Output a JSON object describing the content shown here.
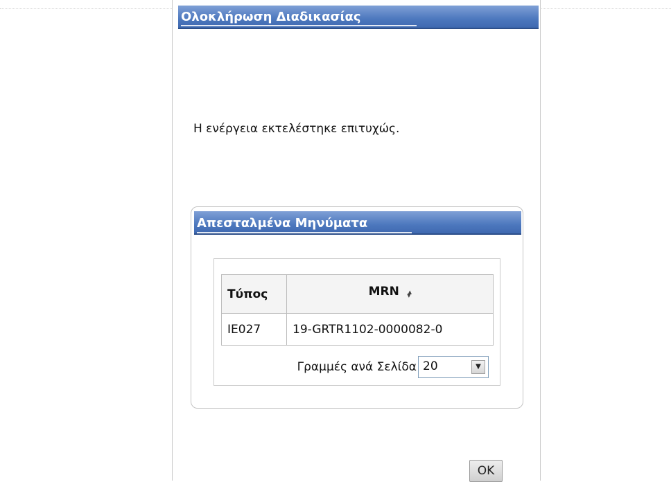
{
  "dialog": {
    "title": "Ολοκλήρωση Διαδικασίας",
    "message": "Η ενέργεια εκτελέστηκε επιτυχώς."
  },
  "sent_messages": {
    "title": "Απεσταλμένα Μηνύματα",
    "columns": [
      "Τύπος",
      "MRN"
    ],
    "sort_icon": "sort-updown-icon",
    "rows": [
      {
        "type": "IE027",
        "mrn": "19-GRTR1102-0000082-0"
      }
    ],
    "rows_per_page_label": "Γραμμές ανά Σελίδα",
    "rows_per_page_value": "20"
  },
  "actions": {
    "ok_label": "OK"
  },
  "colors": {
    "title_bar": "#4d78be",
    "title_text": "#ffffff",
    "panel_border": "#c9c9c9"
  }
}
